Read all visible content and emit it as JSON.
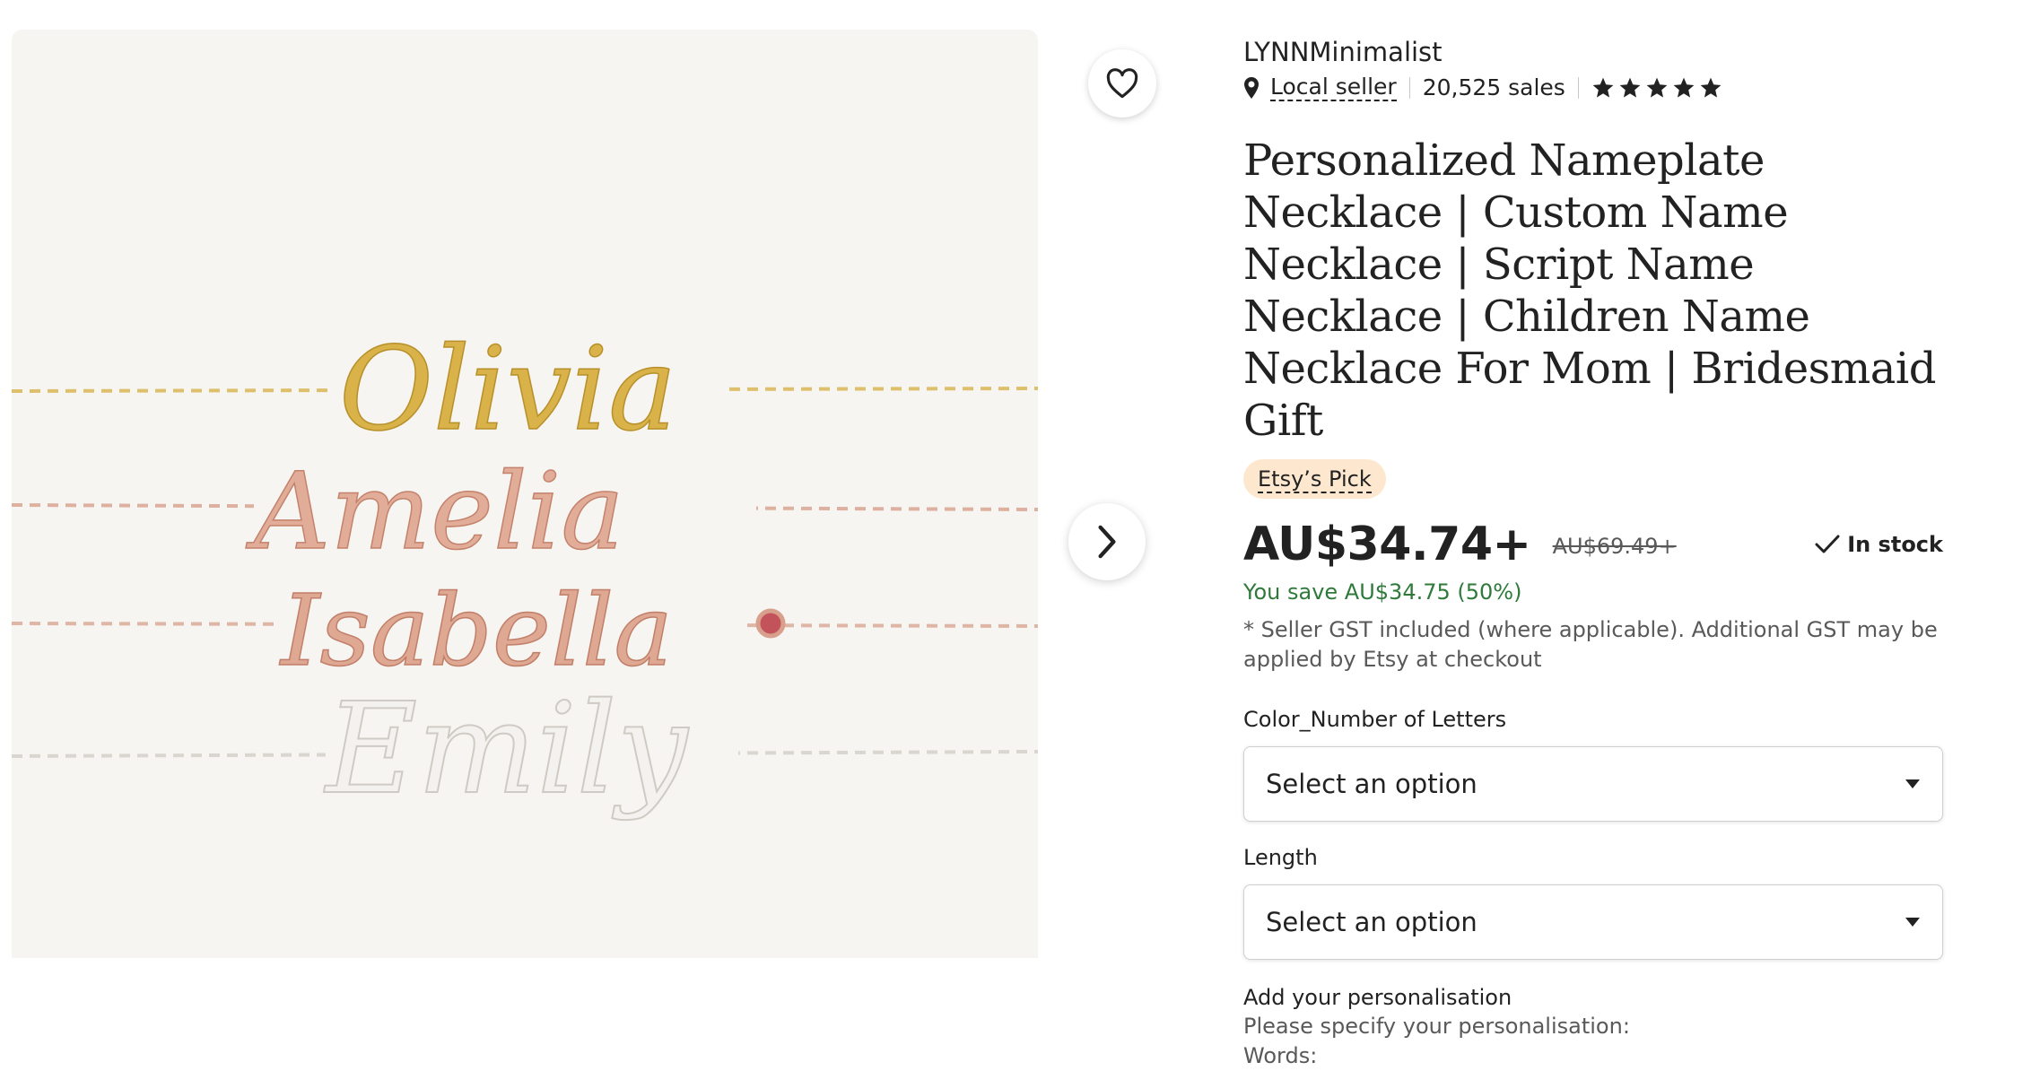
{
  "listing": {
    "shop_name": "LYNNMinimalist",
    "local_seller": "Local seller",
    "sales": "20,525 sales",
    "rating_stars": 5,
    "title": "Personalized Nameplate Necklace | Custom Name Necklace | Script Name Necklace | Children Name Necklace For Mom | Bridesmaid Gift",
    "badge": "Etsy’s Pick",
    "price": "AU$34.74+",
    "old_price": "AU$69.49+",
    "stock": "In stock",
    "savings": "You save AU$34.75 (50%)",
    "gst_note": "* Seller GST included (where applicable). Additional GST may be applied by Etsy at checkout"
  },
  "options": {
    "color_label": "Color_Number of Letters",
    "color_value": "Select an option",
    "length_label": "Length",
    "length_value": "Select an option"
  },
  "personalisation": {
    "label": "Add your personalisation",
    "line1": "Please specify your personalisation:",
    "line2": "Words:"
  },
  "photo": {
    "names": [
      "Olivia",
      "Amelia",
      "Isabella",
      "Emily"
    ]
  },
  "colors": {
    "gold": "#d9b24a",
    "rose": "#d8a08c",
    "silver": "#e4e2de",
    "badge_bg": "#fde8cf",
    "save_green": "#2f7a3a"
  },
  "icons": {
    "favorite": "heart-icon",
    "next": "chevron-right-icon",
    "location": "location-pin-icon",
    "rating": "star-icon",
    "stock": "checkmark-icon",
    "dropdown": "caret-down-icon"
  }
}
